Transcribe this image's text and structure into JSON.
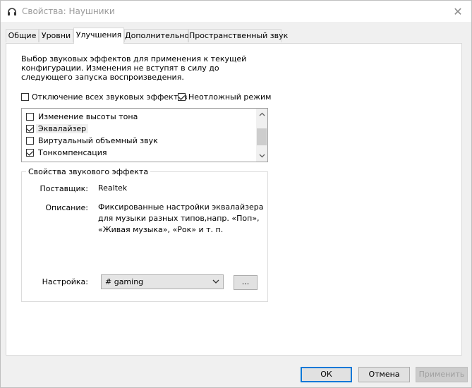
{
  "window": {
    "title": "Свойства: Наушники",
    "close_glyph": "✕"
  },
  "tabs": [
    {
      "label": "Общие",
      "active": false
    },
    {
      "label": "Уровни",
      "active": false
    },
    {
      "label": "Улучшения",
      "active": true
    },
    {
      "label": "Дополнительно",
      "active": false
    },
    {
      "label": "Пространственный звук",
      "active": false
    }
  ],
  "enhancements": {
    "description": "Выбор звуковых эффектов для применения к текущей конфигурации. Изменения не вступят в силу до следующего запуска воспроизведения.",
    "disable_all": {
      "label": "Отключение всех звуковых эффектов",
      "checked": false
    },
    "immediate_mode": {
      "label": "Неотложный режим",
      "checked": true
    },
    "effects": [
      {
        "label": "Изменение высоты тона",
        "checked": false
      },
      {
        "label": "Эквалайзер",
        "checked": true,
        "selected": true
      },
      {
        "label": "Виртуальный объемный звук",
        "checked": false
      },
      {
        "label": "Тонкомпенсация",
        "checked": true
      }
    ]
  },
  "effect_properties": {
    "title": "Свойства звукового эффекта",
    "provider_label": "Поставщик:",
    "provider_value": "Realtek",
    "description_label": "Описание:",
    "description_value": "Фиксированные настройки эквалайзера для музыки разных типов,напр. «Поп», «Живая музыка», «Рок» и т. п.",
    "setting_label": "Настройка:",
    "setting_value": "# gaming",
    "more_button": "..."
  },
  "buttons": {
    "ok": "ОК",
    "cancel": "Отмена",
    "apply": "Применить"
  },
  "icons": {
    "title_icon": "headphones-icon",
    "chevron": "chevron-down-icon"
  }
}
